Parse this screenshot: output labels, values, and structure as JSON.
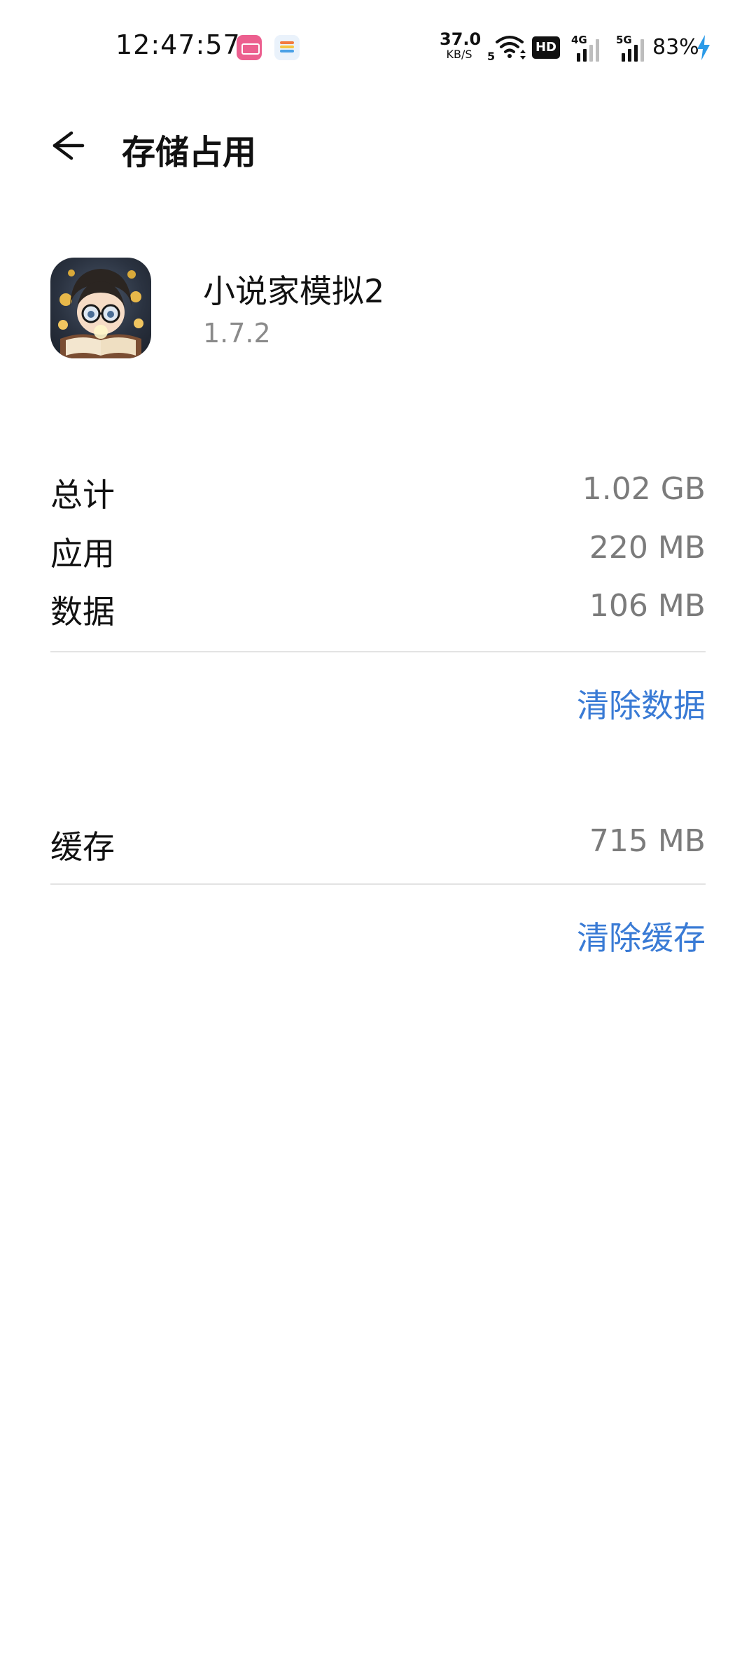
{
  "status_bar": {
    "time": "12:47:57",
    "net_speed_value": "37.0",
    "net_speed_unit": "KB/S",
    "wifi_badge": "5",
    "hd_label": "HD",
    "sig1_label": "4G",
    "sig2_label": "5G",
    "battery": "83%"
  },
  "header": {
    "title": "存储占用"
  },
  "app": {
    "name": "小说家模拟2",
    "version": "1.7.2"
  },
  "storage": {
    "total": {
      "label": "总计",
      "value": "1.02 GB"
    },
    "app": {
      "label": "应用",
      "value": "220 MB"
    },
    "data": {
      "label": "数据",
      "value": "106 MB"
    },
    "clear_data_label": "清除数据",
    "cache": {
      "label": "缓存",
      "value": "715 MB"
    },
    "clear_cache_label": "清除缓存"
  },
  "colors": {
    "accent": "#3a7bd5",
    "secondary_text": "#7b7b7b",
    "divider": "#e3e3e3"
  },
  "icons": [
    "back-arrow-icon",
    "wifi-icon",
    "hd-icon",
    "signal-icon",
    "bolt-icon",
    "app-icon"
  ]
}
